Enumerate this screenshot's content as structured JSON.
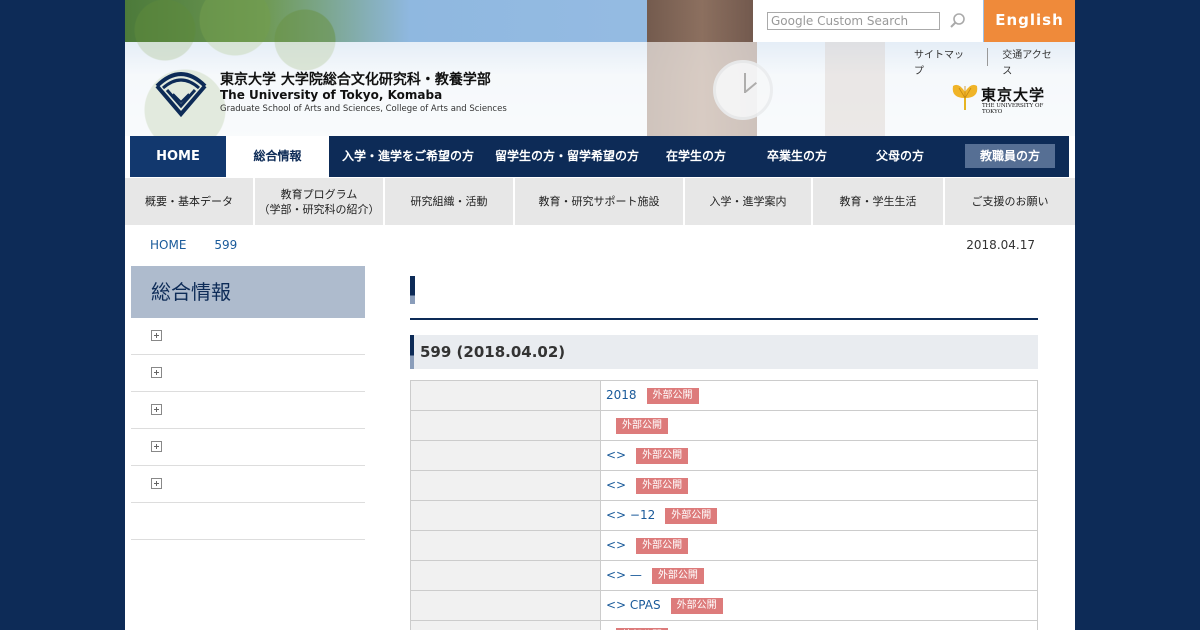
{
  "header": {
    "search_placeholder": "Google Custom Search",
    "english_label": "English",
    "util_links": [
      "サイトマップ",
      "交通アクセス"
    ],
    "logo_ja": "東京大学 大学院総合文化研究科・教養学部",
    "logo_en": "The University of Tokyo, Komaba",
    "logo_sub": "Graduate School of Arts and Sciences, College of Arts and Sciences",
    "utokyo_ja": "東京大学",
    "utokyo_en": "THE UNIVERSITY OF TOKYO"
  },
  "gnav": [
    {
      "label": "HOME"
    },
    {
      "label": "総合情報"
    },
    {
      "label": "入学・進学をご希望の方"
    },
    {
      "label": "留学生の方・留学希望の方"
    },
    {
      "label": "在学生の方"
    },
    {
      "label": "卒業生の方"
    },
    {
      "label": "父母の方"
    },
    {
      "label": "教職員の方"
    }
  ],
  "subnav": [
    {
      "line1": "概要・基本データ",
      "line2": ""
    },
    {
      "line1": "教育プログラム",
      "line2": "（学部・研究科の紹介）"
    },
    {
      "line1": "研究組織・活動",
      "line2": ""
    },
    {
      "line1": "教育・研究サポート施設",
      "line2": ""
    },
    {
      "line1": "入学・進学案内",
      "line2": ""
    },
    {
      "line1": "教育・学生生活",
      "line2": ""
    },
    {
      "line1": "ご支援のお願い",
      "line2": ""
    }
  ],
  "breadcrumb": [
    "HOME",
    "599"
  ],
  "date": "2018.04.17",
  "sidebar": {
    "title": "総合情報"
  },
  "main": {
    "section_title": "599 (2018.04.02)",
    "rows": [
      {
        "text": "2018",
        "tag": "外部公開"
      },
      {
        "text": "",
        "tag": "外部公開"
      },
      {
        "text": "<>",
        "tag": "外部公開"
      },
      {
        "text": "<>",
        "tag": "外部公開"
      },
      {
        "text": "<> −12",
        "tag": "外部公開"
      },
      {
        "text": "<>",
        "tag": "外部公開"
      },
      {
        "text": "<> —",
        "tag": "外部公開"
      },
      {
        "text": "<> CPAS",
        "tag": "外部公開"
      },
      {
        "text": "",
        "tag": "外部公開"
      }
    ]
  },
  "colors": {
    "navy": "#0d2b57",
    "english_orange": "#ef8a3a",
    "tag_red": "#dd7b7b",
    "link_blue": "#1a5a9a"
  }
}
